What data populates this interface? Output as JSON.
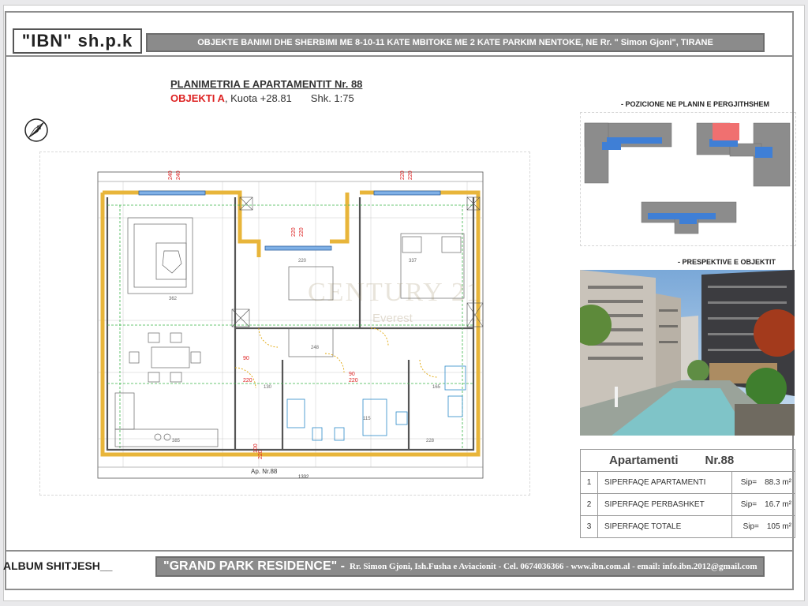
{
  "header": {
    "company": "\"IBN\"  sh.p.k",
    "project": "OBJEKTE BANIMI DHE SHERBIMI  ME 8-10-11 KATE MBITOKE ME 2 KATE PARKIM NENTOKE, NE Rr. \" Simon Gjoni\", TIRANE"
  },
  "plan": {
    "title": "PLANIMETRIA E APARTAMENTIT Nr. 88",
    "object": "OBJEKTI A",
    "level": ",  Kuota  +28.81",
    "scale": "Shk. 1:75",
    "apartment_tag": "Ap. Nr.88",
    "total_width": "1332",
    "watermark": "CENTURY 21",
    "watermark_sub": "Everest",
    "dims": {
      "d240a": "240",
      "d240b": "240",
      "d220a": "220",
      "d220b": "220",
      "d220c": "220",
      "d220d": "220",
      "d100": "100",
      "d220e": "220",
      "d90a": "90",
      "d220f": "220",
      "d90b": "90",
      "d220g": "220",
      "d362": "362",
      "d337": "337",
      "d248": "248",
      "d220h": "220",
      "d130": "130",
      "d165": "165",
      "d385": "385",
      "d228": "228",
      "d115": "115"
    }
  },
  "position": {
    "label": "- POZICIONE NE PLANIN E PERGJITHSHEM"
  },
  "perspective": {
    "label": "- PRESPEKTIVE E OBJEKTIT"
  },
  "areas": {
    "header_label": "Apartamenti",
    "header_number": "Nr.88",
    "rows": [
      {
        "n": "1",
        "label": "SIPERFAQE APARTAMENTI",
        "prefix": "Sip=",
        "value": "88.3 m²"
      },
      {
        "n": "2",
        "label": "SIPERFAQE PERBASHKET",
        "prefix": "Sip=",
        "value": "16.7 m²"
      },
      {
        "n": "3",
        "label": "SIPERFAQE TOTALE",
        "prefix": "Sip=",
        "value": "105 m²"
      }
    ]
  },
  "footer": {
    "album": "ALBUM SHITJESH__",
    "residence": "\"GRAND PARK RESIDENCE\" -",
    "contact": "Rr. Simon Gjoni, Ish.Fusha e Aviacionit - Cel. 0674036366 - www.ibn.com.al - email: info.ibn.2012@gmail.com"
  },
  "colors": {
    "header_bar": "#8b8b8b",
    "highlight_red": "#d22222",
    "apartment_blue": "#3f7fd6",
    "wall_yellow": "#e8b53a"
  }
}
